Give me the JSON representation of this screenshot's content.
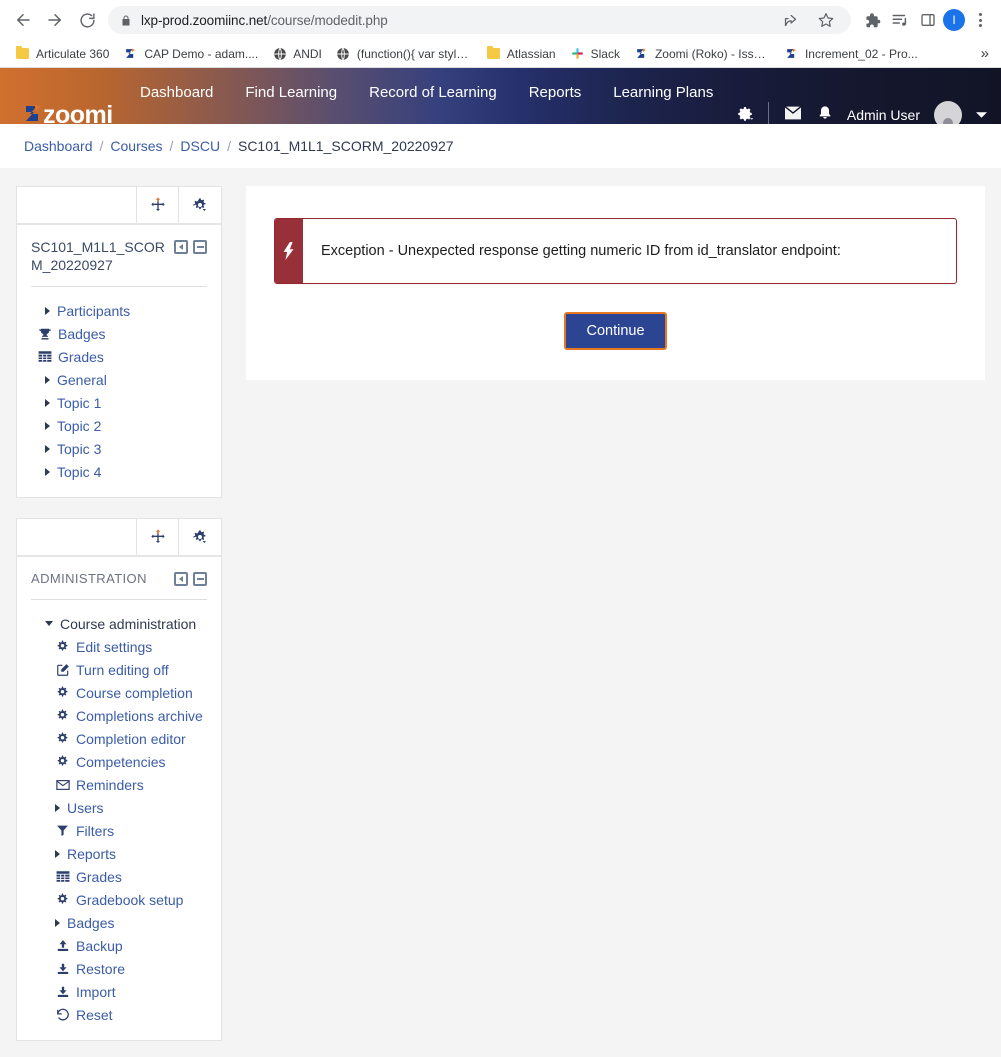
{
  "browser": {
    "back_icon": "back-arrow-icon",
    "forward_icon": "forward-arrow-icon",
    "reload_icon": "reload-icon",
    "url_host": "lxp-prod.zoomiinc.net",
    "url_path": "/course/modedit.php",
    "lock_icon": "lock-icon",
    "share_icon": "share-icon",
    "bookmark_star_icon": "star-icon",
    "extensions_icon": "puzzle-icon",
    "reading_list_icon": "reading-list-icon",
    "side_panel_icon": "side-panel-icon",
    "profile_initial": "I",
    "menu_icon": "three-dot-menu-icon",
    "bookmarks": [
      {
        "label": "Articulate 360",
        "icon": "folder-icon"
      },
      {
        "label": "CAP Demo - adam....",
        "icon": "zoomi-favicon"
      },
      {
        "label": "ANDI",
        "icon": "globe-icon"
      },
      {
        "label": "(function(){ var style...",
        "icon": "globe-icon"
      },
      {
        "label": "Atlassian",
        "icon": "folder-icon"
      },
      {
        "label": "Slack",
        "icon": "slack-icon"
      },
      {
        "label": "Zoomi (Roko) - Issu...",
        "icon": "zoomi-favicon"
      },
      {
        "label": "Increment_02 - Pro...",
        "icon": "zoomi-favicon"
      }
    ],
    "bookmarks_overflow": "»"
  },
  "navbar": {
    "brand": "zoomi",
    "links": [
      "Dashboard",
      "Find Learning",
      "Record of Learning",
      "Reports",
      "Learning Plans"
    ],
    "gear_icon": "gear-dropdown-icon",
    "messages_icon": "envelope-icon",
    "notifications_icon": "bell-icon",
    "user_name": "Admin User",
    "avatar_icon": "user-avatar",
    "caret_icon": "chevron-down-icon"
  },
  "breadcrumb": {
    "items": [
      "Dashboard",
      "Courses",
      "DSCU"
    ],
    "current": "SC101_M1L1_SCORM_20220927",
    "separator": "/"
  },
  "sidebar": {
    "blocks": [
      {
        "move_icon": "move-handle-icon",
        "config_icon": "gear-dropdown-icon",
        "title": "SC101_M1L1_SCORM_20220927",
        "dock_icon": "dock-block-icon",
        "collapse_icon": "collapse-block-icon",
        "items": [
          {
            "label": "Participants",
            "icon": "twisty-right-icon"
          },
          {
            "label": "Badges",
            "icon": "trophy-icon"
          },
          {
            "label": "Grades",
            "icon": "grid-table-icon"
          },
          {
            "label": "General",
            "icon": "twisty-right-icon"
          },
          {
            "label": "Topic 1",
            "icon": "twisty-right-icon"
          },
          {
            "label": "Topic 2",
            "icon": "twisty-right-icon"
          },
          {
            "label": "Topic 3",
            "icon": "twisty-right-icon"
          },
          {
            "label": "Topic 4",
            "icon": "twisty-right-icon"
          }
        ]
      },
      {
        "move_icon": "move-handle-icon",
        "config_icon": "gear-dropdown-icon",
        "title": "ADMINISTRATION",
        "dock_icon": "dock-block-icon",
        "collapse_icon": "collapse-block-icon",
        "items": [
          {
            "label": "Course administration",
            "icon": "twisty-down-icon",
            "level": "root"
          },
          {
            "label": "Edit settings",
            "icon": "gear-icon",
            "level": "sub"
          },
          {
            "label": "Turn editing off",
            "icon": "pencil-square-icon",
            "level": "sub"
          },
          {
            "label": "Course completion",
            "icon": "gear-icon",
            "level": "sub"
          },
          {
            "label": "Completions archive",
            "icon": "gear-icon",
            "level": "sub"
          },
          {
            "label": "Completion editor",
            "icon": "gear-icon",
            "level": "sub"
          },
          {
            "label": "Competencies",
            "icon": "gear-icon",
            "level": "sub"
          },
          {
            "label": "Reminders",
            "icon": "envelope-icon",
            "level": "sub"
          },
          {
            "label": "Users",
            "icon": "twisty-right-icon",
            "level": "sub"
          },
          {
            "label": "Filters",
            "icon": "funnel-icon",
            "level": "sub"
          },
          {
            "label": "Reports",
            "icon": "twisty-right-icon",
            "level": "sub"
          },
          {
            "label": "Grades",
            "icon": "grid-table-icon",
            "level": "sub"
          },
          {
            "label": "Gradebook setup",
            "icon": "gear-icon",
            "level": "sub"
          },
          {
            "label": "Badges",
            "icon": "twisty-right-icon",
            "level": "sub"
          },
          {
            "label": "Backup",
            "icon": "upload-icon",
            "level": "sub"
          },
          {
            "label": "Restore",
            "icon": "download-icon",
            "level": "sub"
          },
          {
            "label": "Import",
            "icon": "download-icon",
            "level": "sub"
          },
          {
            "label": "Reset",
            "icon": "reset-undo-icon",
            "level": "sub"
          }
        ]
      }
    ]
  },
  "main": {
    "alert": {
      "icon": "lightning-bolt-icon",
      "message": "Exception - Unexpected response getting numeric ID from id_translator endpoint:"
    },
    "continue_label": "Continue"
  },
  "colors": {
    "accent_orange": "#e87722",
    "nav_dark": "#121426",
    "link_blue": "#3b5ca8",
    "button_blue": "#2b4593",
    "alert_red": "#98303a"
  }
}
